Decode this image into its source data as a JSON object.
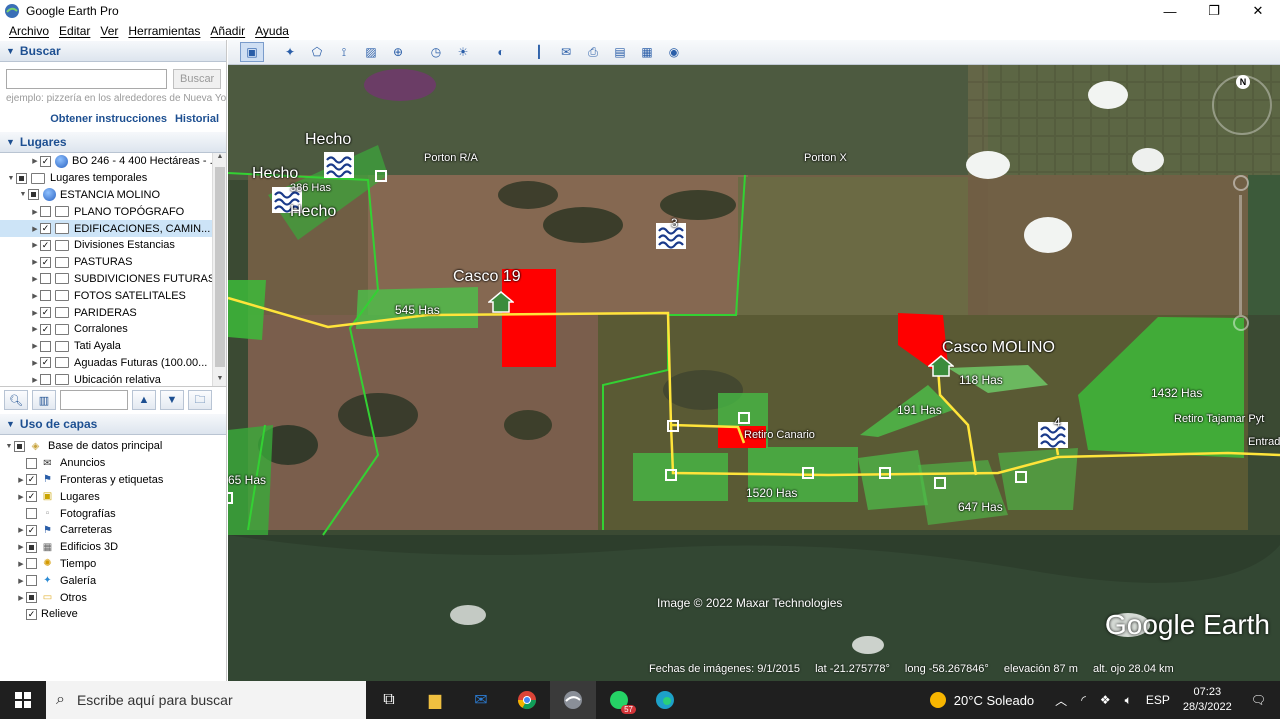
{
  "window": {
    "title": "Google Earth Pro",
    "minimize": "—",
    "maximize": "❐",
    "close": "✕"
  },
  "menu": [
    "Archivo",
    "Editar",
    "Ver",
    "Herramientas",
    "Añadir",
    "Ayuda"
  ],
  "search": {
    "header": "Buscar",
    "placeholder": "",
    "button": "Buscar",
    "hint": "ejemplo: pizzería en los alrededores de Nueva Yo",
    "link_directions": "Obtener instrucciones",
    "link_history": "Historial"
  },
  "places": {
    "header": "Lugares",
    "items": [
      {
        "label": "BO 246 - 4 400 Hectáreas - ...",
        "checked": true,
        "icon": "globe-icon",
        "indent": 2
      },
      {
        "label": "Lugares temporales",
        "checked": "partial",
        "icon": "folder-icon",
        "indent": 0
      },
      {
        "label": "ESTANCIA MOLINO",
        "checked": "partial",
        "icon": "globe-icon",
        "indent": 1
      },
      {
        "label": "PLANO TOPÓGRAFO",
        "checked": false,
        "icon": "folder-icon",
        "indent": 2
      },
      {
        "label": "EDIFICACIONES, CAMIN...",
        "checked": true,
        "icon": "folder-icon",
        "indent": 2,
        "selected": true
      },
      {
        "label": "Divisiones Estancias",
        "checked": true,
        "icon": "folder-icon",
        "indent": 2
      },
      {
        "label": "PASTURAS",
        "checked": true,
        "icon": "folder-icon",
        "indent": 2
      },
      {
        "label": "SUBDIVICIONES FUTURAS",
        "checked": false,
        "icon": "folder-icon",
        "indent": 2
      },
      {
        "label": "FOTOS SATELITALES",
        "checked": false,
        "icon": "folder-icon",
        "indent": 2
      },
      {
        "label": "PARIDERAS",
        "checked": true,
        "icon": "folder-icon",
        "indent": 2
      },
      {
        "label": "Corralones",
        "checked": true,
        "icon": "folder-icon",
        "indent": 2
      },
      {
        "label": "Tati Ayala",
        "checked": false,
        "icon": "folder-icon",
        "indent": 2
      },
      {
        "label": "Aguadas Futuras (100.00...",
        "checked": true,
        "icon": "folder-icon",
        "indent": 2
      },
      {
        "label": "Ubicación relativa",
        "checked": false,
        "icon": "folder-icon",
        "indent": 2
      }
    ]
  },
  "layers": {
    "header": "Uso de capas",
    "items": [
      {
        "label": "Base de datos principal",
        "checked": "partial",
        "icon": "layers-icon",
        "indent": 0
      },
      {
        "label": "Anuncios",
        "checked": false,
        "icon": "envelope-icon",
        "indent": 1
      },
      {
        "label": "Fronteras y etiquetas",
        "checked": true,
        "icon": "flag-icon",
        "indent": 1
      },
      {
        "label": "Lugares",
        "checked": true,
        "icon": "square-icon",
        "indent": 1
      },
      {
        "label": "Fotografías",
        "checked": false,
        "icon": "camera-icon",
        "indent": 1
      },
      {
        "label": "Carreteras",
        "checked": true,
        "icon": "road-icon",
        "indent": 1
      },
      {
        "label": "Edificios 3D",
        "checked": "partial",
        "icon": "building-icon",
        "indent": 1
      },
      {
        "label": "Tiempo",
        "checked": false,
        "icon": "weather-icon",
        "indent": 1
      },
      {
        "label": "Galería",
        "checked": false,
        "icon": "star-icon",
        "indent": 1
      },
      {
        "label": "Otros",
        "checked": "partial",
        "icon": "folder-icon",
        "indent": 1
      },
      {
        "label": "Relieve",
        "checked": true,
        "icon": "",
        "indent": 1
      }
    ]
  },
  "toolbar_icons": [
    "sidebar-toggle-icon",
    "placemark-icon",
    "polygon-icon",
    "path-icon",
    "overlay-icon",
    "tour-icon",
    "history-icon",
    "sun-icon",
    "planet-icon",
    "ruler-icon",
    "email-icon",
    "print-icon",
    "save-image-icon",
    "map-view-icon",
    "maps-icon"
  ],
  "map_labels": [
    {
      "text": "Hecho"
    },
    {
      "text": "Hecho"
    },
    {
      "text": "386 Has"
    },
    {
      "text": "Hecho"
    },
    {
      "text": "Porton R/A"
    },
    {
      "text": "Porton X"
    },
    {
      "text": "3"
    },
    {
      "text": "Casco 19"
    },
    {
      "text": "545 Has"
    },
    {
      "text": "Casco MOLINO"
    },
    {
      "text": "118 Has"
    },
    {
      "text": "191 Has"
    },
    {
      "text": "1432 Has"
    },
    {
      "text": "Retiro Tajamar Pyt"
    },
    {
      "text": "Entrad"
    },
    {
      "text": "4"
    },
    {
      "text": "Retiro Canario"
    },
    {
      "text": "1520 Has"
    },
    {
      "text": "647 Has"
    },
    {
      "text": "65 Has"
    }
  ],
  "map_footer": {
    "credit": "Image © 2022 Maxar Technologies",
    "brand": "Google Earth",
    "dates": "Fechas de imágenes: 9/1/2015",
    "lat": "lat  -21.275778°",
    "long": "long  -58.267846°",
    "elev": "elevación   87 m",
    "eye": "alt. ojo  28.04 km",
    "compass_n": "N"
  },
  "taskbar": {
    "search_placeholder": "Escribe aquí para buscar",
    "whatsapp_badge": "57",
    "weather": "20°C  Soleado",
    "lang": "ESP",
    "time": "07:23",
    "date": "28/3/2022"
  }
}
